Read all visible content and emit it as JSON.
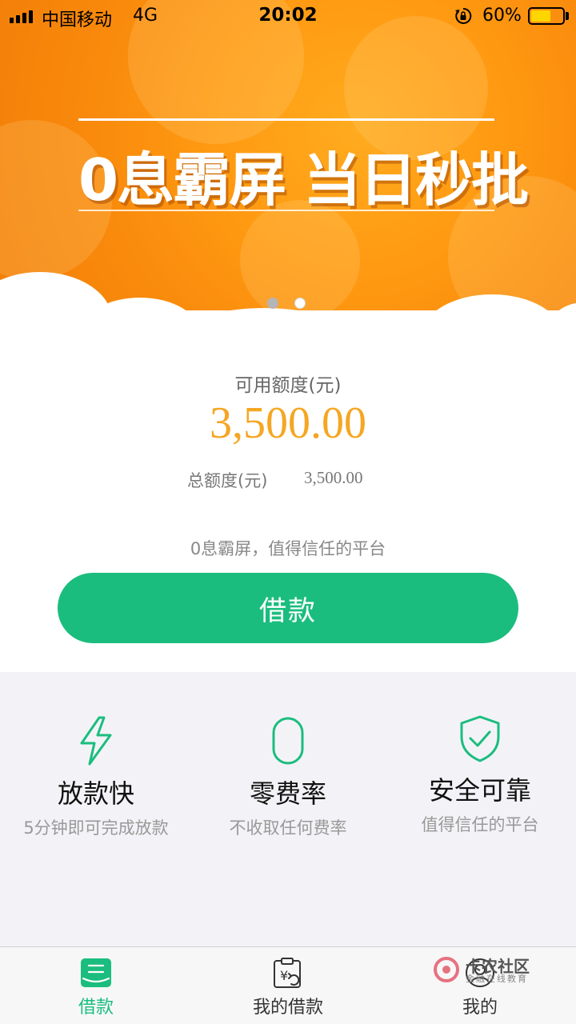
{
  "status_bar": {
    "carrier": "中国移动",
    "network": "4G",
    "time": "20:02",
    "battery": "60%"
  },
  "banner": {
    "headline": "0息霸屏 当日秒批",
    "slide_count": 2,
    "active_slide": 2
  },
  "credit": {
    "available_label": "可用额度(元)",
    "available_amount": "3,500.00",
    "total_label": "总额度(元)",
    "total_amount": "3,500.00",
    "slogan": "0息霸屏，值得信任的平台",
    "borrow_button": "借款"
  },
  "features": [
    {
      "icon": "lightning-icon",
      "title": "放款快",
      "subtitle": "5分钟即可完成放款"
    },
    {
      "icon": "zero-icon",
      "title": "零费率",
      "subtitle": "不收取任何费率"
    },
    {
      "icon": "shield-check-icon",
      "title": "安全可靠",
      "subtitle": "值得信任的平台"
    }
  ],
  "tabs": [
    {
      "icon": "borrow-tab-icon",
      "label": "借款",
      "active": true
    },
    {
      "icon": "my-loans-icon",
      "label": "我的借款",
      "active": false
    },
    {
      "icon": "profile-icon",
      "label": "我的",
      "active": false
    }
  ],
  "watermark": {
    "name": "卡农社区",
    "sub": "金融在线教育"
  },
  "colors": {
    "accent_green": "#1bbd7e",
    "amount_orange": "#f5a623",
    "banner_orange": "#ff9a12"
  }
}
